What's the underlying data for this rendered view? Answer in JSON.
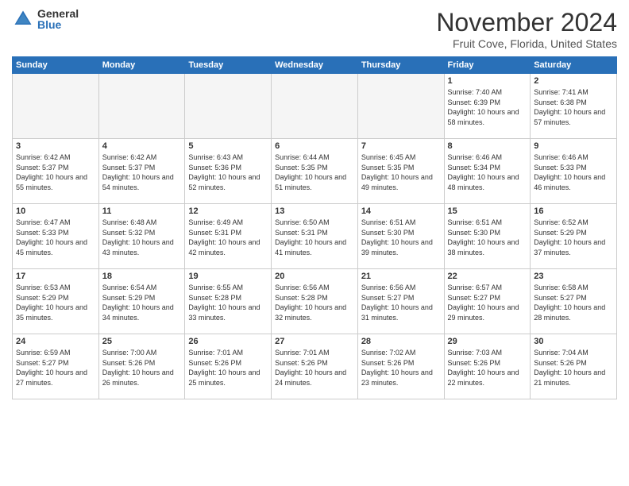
{
  "logo": {
    "general": "General",
    "blue": "Blue"
  },
  "header": {
    "title": "November 2024",
    "subtitle": "Fruit Cove, Florida, United States"
  },
  "days_of_week": [
    "Sunday",
    "Monday",
    "Tuesday",
    "Wednesday",
    "Thursday",
    "Friday",
    "Saturday"
  ],
  "weeks": [
    [
      {
        "day": "",
        "info": ""
      },
      {
        "day": "",
        "info": ""
      },
      {
        "day": "",
        "info": ""
      },
      {
        "day": "",
        "info": ""
      },
      {
        "day": "",
        "info": ""
      },
      {
        "day": "1",
        "info": "Sunrise: 7:40 AM\nSunset: 6:39 PM\nDaylight: 10 hours and 58 minutes."
      },
      {
        "day": "2",
        "info": "Sunrise: 7:41 AM\nSunset: 6:38 PM\nDaylight: 10 hours and 57 minutes."
      }
    ],
    [
      {
        "day": "3",
        "info": "Sunrise: 6:42 AM\nSunset: 5:37 PM\nDaylight: 10 hours and 55 minutes."
      },
      {
        "day": "4",
        "info": "Sunrise: 6:42 AM\nSunset: 5:37 PM\nDaylight: 10 hours and 54 minutes."
      },
      {
        "day": "5",
        "info": "Sunrise: 6:43 AM\nSunset: 5:36 PM\nDaylight: 10 hours and 52 minutes."
      },
      {
        "day": "6",
        "info": "Sunrise: 6:44 AM\nSunset: 5:35 PM\nDaylight: 10 hours and 51 minutes."
      },
      {
        "day": "7",
        "info": "Sunrise: 6:45 AM\nSunset: 5:35 PM\nDaylight: 10 hours and 49 minutes."
      },
      {
        "day": "8",
        "info": "Sunrise: 6:46 AM\nSunset: 5:34 PM\nDaylight: 10 hours and 48 minutes."
      },
      {
        "day": "9",
        "info": "Sunrise: 6:46 AM\nSunset: 5:33 PM\nDaylight: 10 hours and 46 minutes."
      }
    ],
    [
      {
        "day": "10",
        "info": "Sunrise: 6:47 AM\nSunset: 5:33 PM\nDaylight: 10 hours and 45 minutes."
      },
      {
        "day": "11",
        "info": "Sunrise: 6:48 AM\nSunset: 5:32 PM\nDaylight: 10 hours and 43 minutes."
      },
      {
        "day": "12",
        "info": "Sunrise: 6:49 AM\nSunset: 5:31 PM\nDaylight: 10 hours and 42 minutes."
      },
      {
        "day": "13",
        "info": "Sunrise: 6:50 AM\nSunset: 5:31 PM\nDaylight: 10 hours and 41 minutes."
      },
      {
        "day": "14",
        "info": "Sunrise: 6:51 AM\nSunset: 5:30 PM\nDaylight: 10 hours and 39 minutes."
      },
      {
        "day": "15",
        "info": "Sunrise: 6:51 AM\nSunset: 5:30 PM\nDaylight: 10 hours and 38 minutes."
      },
      {
        "day": "16",
        "info": "Sunrise: 6:52 AM\nSunset: 5:29 PM\nDaylight: 10 hours and 37 minutes."
      }
    ],
    [
      {
        "day": "17",
        "info": "Sunrise: 6:53 AM\nSunset: 5:29 PM\nDaylight: 10 hours and 35 minutes."
      },
      {
        "day": "18",
        "info": "Sunrise: 6:54 AM\nSunset: 5:29 PM\nDaylight: 10 hours and 34 minutes."
      },
      {
        "day": "19",
        "info": "Sunrise: 6:55 AM\nSunset: 5:28 PM\nDaylight: 10 hours and 33 minutes."
      },
      {
        "day": "20",
        "info": "Sunrise: 6:56 AM\nSunset: 5:28 PM\nDaylight: 10 hours and 32 minutes."
      },
      {
        "day": "21",
        "info": "Sunrise: 6:56 AM\nSunset: 5:27 PM\nDaylight: 10 hours and 31 minutes."
      },
      {
        "day": "22",
        "info": "Sunrise: 6:57 AM\nSunset: 5:27 PM\nDaylight: 10 hours and 29 minutes."
      },
      {
        "day": "23",
        "info": "Sunrise: 6:58 AM\nSunset: 5:27 PM\nDaylight: 10 hours and 28 minutes."
      }
    ],
    [
      {
        "day": "24",
        "info": "Sunrise: 6:59 AM\nSunset: 5:27 PM\nDaylight: 10 hours and 27 minutes."
      },
      {
        "day": "25",
        "info": "Sunrise: 7:00 AM\nSunset: 5:26 PM\nDaylight: 10 hours and 26 minutes."
      },
      {
        "day": "26",
        "info": "Sunrise: 7:01 AM\nSunset: 5:26 PM\nDaylight: 10 hours and 25 minutes."
      },
      {
        "day": "27",
        "info": "Sunrise: 7:01 AM\nSunset: 5:26 PM\nDaylight: 10 hours and 24 minutes."
      },
      {
        "day": "28",
        "info": "Sunrise: 7:02 AM\nSunset: 5:26 PM\nDaylight: 10 hours and 23 minutes."
      },
      {
        "day": "29",
        "info": "Sunrise: 7:03 AM\nSunset: 5:26 PM\nDaylight: 10 hours and 22 minutes."
      },
      {
        "day": "30",
        "info": "Sunrise: 7:04 AM\nSunset: 5:26 PM\nDaylight: 10 hours and 21 minutes."
      }
    ]
  ]
}
